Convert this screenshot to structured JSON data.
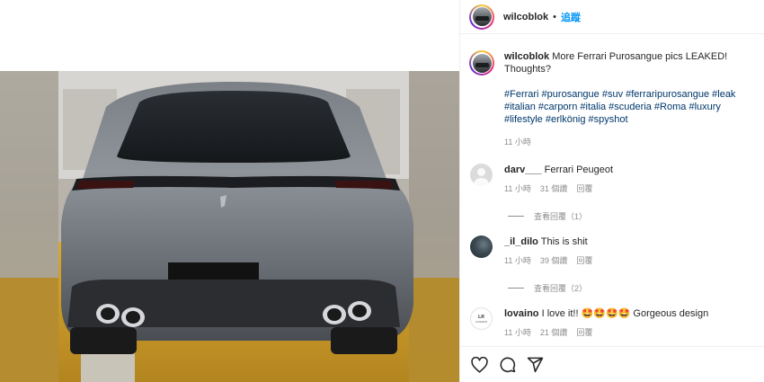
{
  "post": {
    "username": "wilcoblok",
    "separator": "•",
    "follow_label": "追蹤",
    "caption_text": "More Ferrari Purosangue pics LEAKED! Thoughts?",
    "hashtags": "#Ferrari #purosangue #suv #ferraripurosangue #leak #italian #carporn #italia #scuderia #Roma #luxury #lifestyle #erlkönig #spyshot",
    "caption_time": "11 小時"
  },
  "comments": [
    {
      "username": "darv___",
      "text": "Ferrari Peugeot",
      "time": "11 小時",
      "likes": "31 個讚",
      "reply": "回覆",
      "view_replies": "查看回覆（1）"
    },
    {
      "username": "_il_dilo",
      "text": "This is shit",
      "time": "11 小時",
      "likes": "39 個讚",
      "reply": "回覆",
      "view_replies": "查看回覆（2）"
    },
    {
      "username": "lovaino",
      "text": "I love it!! 🤩🤩🤩🤩 Gorgeous design",
      "time": "11 小時",
      "likes": "21 個讚",
      "reply": "回覆",
      "avatar_text_top": "LR",
      "avatar_text_bottom": "LOVAINO"
    }
  ],
  "icons": [
    "heart-icon",
    "comment-icon",
    "share-icon"
  ],
  "colors": {
    "link_blue": "#0095f6",
    "hashtag_blue": "#00376b",
    "muted_gray": "#8e8e8e"
  }
}
